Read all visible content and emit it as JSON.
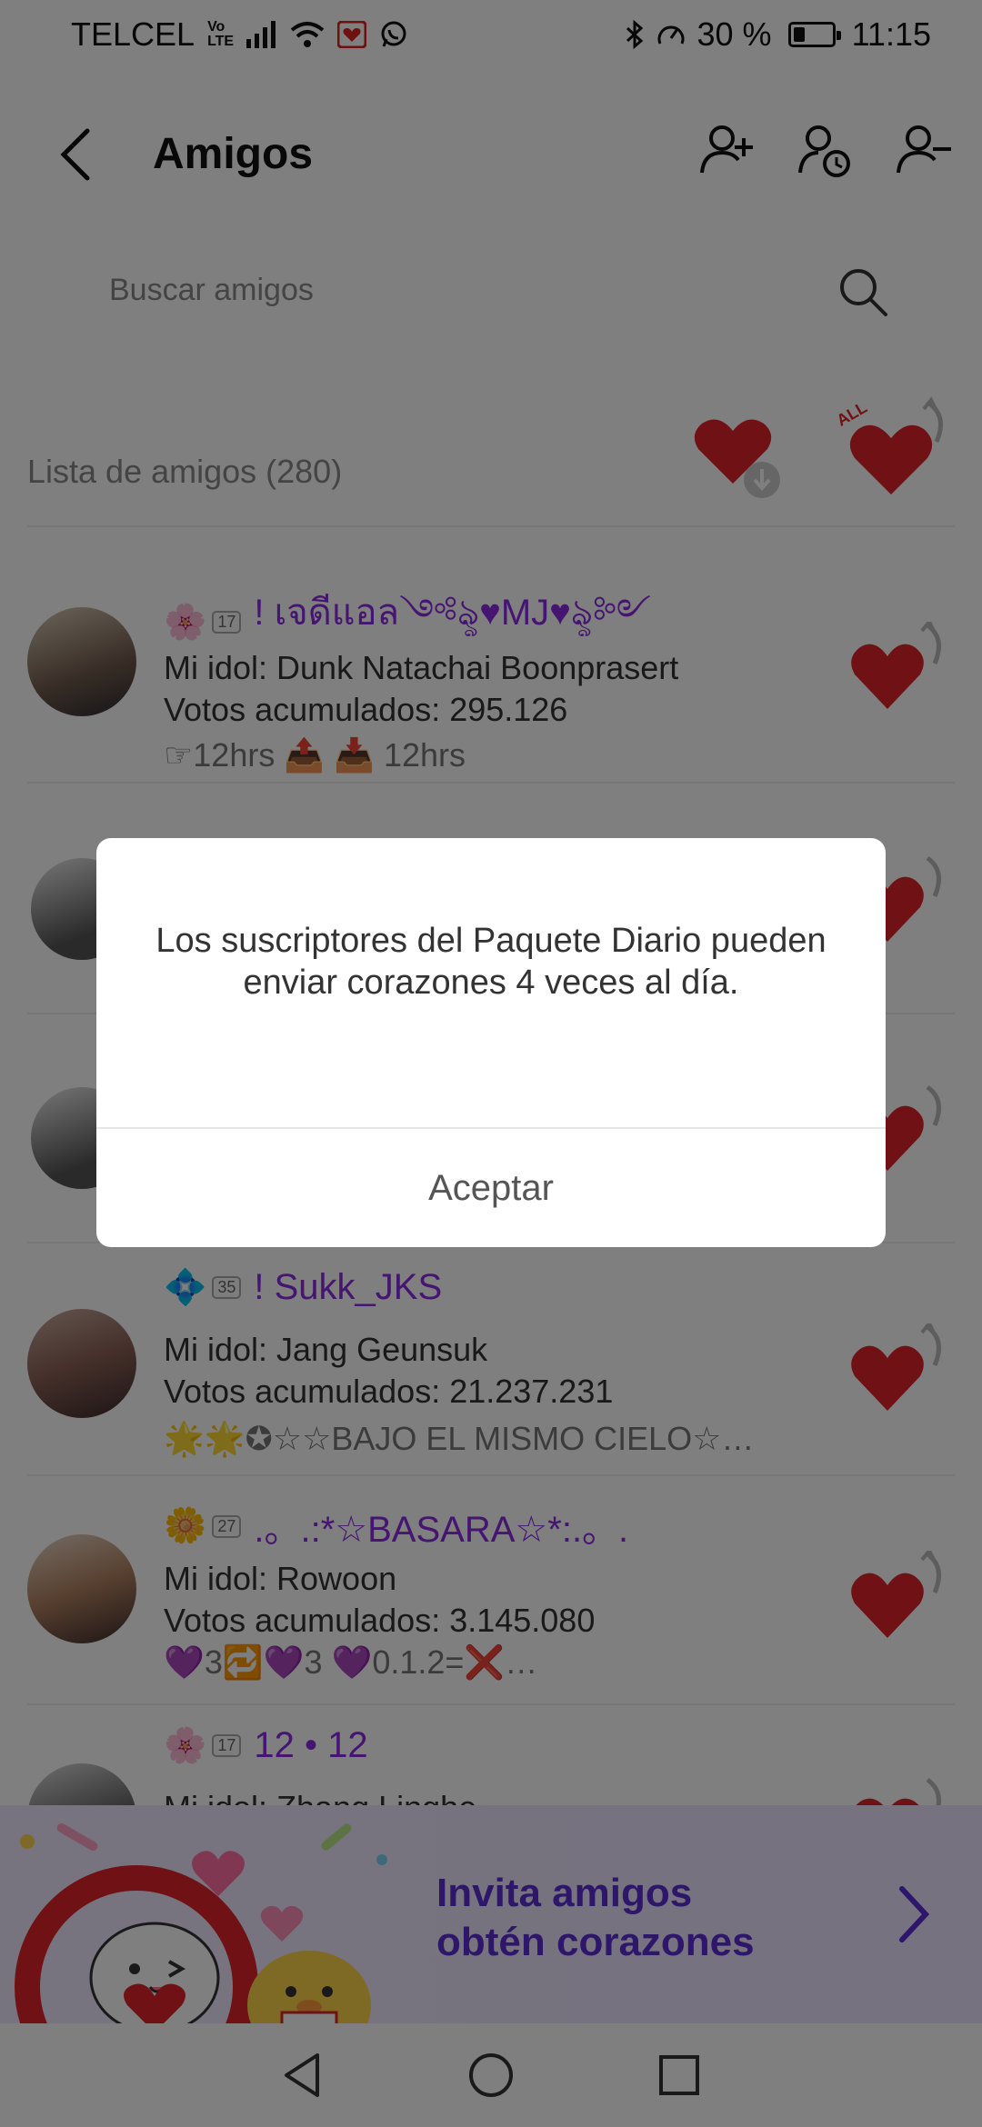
{
  "status_bar": {
    "carrier": "TELCEL",
    "volte_top": "Vo",
    "volte_bottom": "LTE",
    "battery_percent": "30 %",
    "battery_level": 0.3,
    "time": "11:15"
  },
  "header": {
    "title": "Amigos",
    "icons": [
      "back-icon",
      "add-friend-icon",
      "friend-requests-icon",
      "remove-friend-icon"
    ]
  },
  "search": {
    "placeholder": "Buscar amigos"
  },
  "friends_list": {
    "title": "Lista de amigos (280)",
    "heart_all_label": "ALL",
    "rows": [
      {
        "level": "17",
        "name": "! เจดีแอล༺ৡ♥MJ♥ৡ༻",
        "idol": "Mi idol: Dunk Natachai Boonprasert",
        "votes": "Votos acumulados: 295.126",
        "status": "☞12hrs 📤 📥 12hrs"
      },
      {
        "level": "35",
        "name": "! Sukk_JKS",
        "idol": "Mi idol: Jang Geunsuk",
        "votes": "Votos acumulados: 21.237.231",
        "status": "🌟🌟✪☆☆BAJO EL MISMO CIELO☆…"
      },
      {
        "level": "27",
        "name": ".。.:*☆BASARA☆*:.。.",
        "idol": "Mi idol: Rowoon",
        "votes": "Votos acumulados: 3.145.080",
        "status": "💜3🔁💜3 💜0.1.2=❌…"
      },
      {
        "level": "17",
        "name": "12 • 12",
        "idol": "Mi idol: Zhang Linghe",
        "votes": "",
        "status": ""
      }
    ]
  },
  "banner": {
    "line1": "Invita amigos",
    "line2": "obtén corazones"
  },
  "dialog": {
    "message": "Los suscriptores del Paquete Diario pueden enviar corazones 4 veces al día.",
    "button": "Aceptar"
  },
  "colors": {
    "accent_purple": "#8a2be2",
    "heart_red": "#e0252a",
    "banner_text": "#5d2fd4"
  }
}
